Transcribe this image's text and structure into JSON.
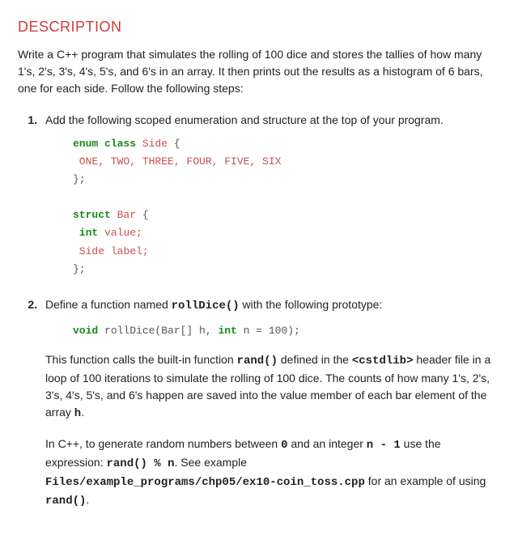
{
  "heading": "DESCRIPTION",
  "intro": "Write a C++ program that simulates the rolling of 100 dice and stores the tallies of how many 1's, 2's, 3's, 4's, 5's, and 6's in an array. It then prints out the results as a histogram of 6 bars, one for each side. Follow the following steps:",
  "step1": {
    "lead": "Add the following scoped enumeration and structure at the top of your program.",
    "code": {
      "l1a": "enum class",
      "l1b": " Side",
      "l1c": " {",
      "l2": " ONE, TWO, THREE, FOUR, FIVE, SIX",
      "l3": "};",
      "l5a": "struct",
      "l5b": " Bar",
      "l5c": " {",
      "l6a": " int",
      "l6b": " value;",
      "l7a": " Side",
      "l7b": " label;",
      "l8": "};"
    }
  },
  "step2": {
    "lead_a": "Define a function named ",
    "lead_fn": "rollDice()",
    "lead_b": " with the following prototype:",
    "proto_kw_void": "void",
    "proto_mid": " rollDice(Bar[] h, ",
    "proto_kw_int": "int",
    "proto_end": " n = 100);",
    "para1_a": "This function calls the built-in function ",
    "para1_rand": "rand()",
    "para1_b": " defined in the ",
    "para1_hdr": "<cstdlib>",
    "para1_c": " header file in a loop of 100 iterations to simulate the rolling of 100 dice. The counts of how many 1's, 2's, 3's, 4's, 5's, and 6's happen are saved into the value member of each bar element of the array ",
    "para1_h": "h",
    "para1_d": ".",
    "para2_a": "In C++, to generate random numbers between ",
    "para2_zero": "0",
    "para2_b": " and an integer ",
    "para2_expr_n": "n - 1",
    "para2_c": " use the expression: ",
    "para2_expr": "rand() % n",
    "para2_d": ". See example ",
    "para2_file": "Files/example_programs/chp05/ex10-coin_toss.cpp",
    "para2_e": " for an example of using ",
    "para2_rand": "rand()",
    "para2_f": "."
  }
}
